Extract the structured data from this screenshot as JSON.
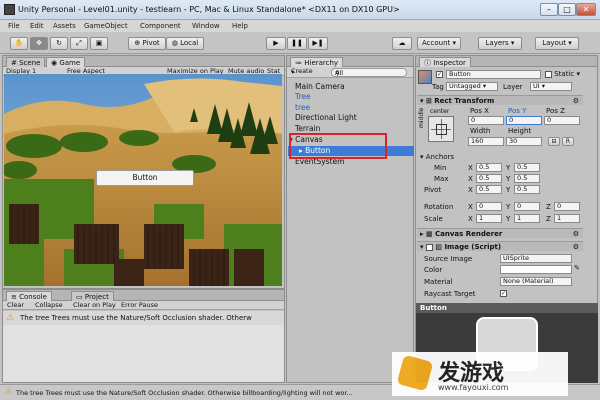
{
  "window": {
    "title": "Unity Personal - Level01.unity - testlearn - PC, Mac & Linux Standalone* <DX11 on DX10 GPU>",
    "controls": [
      "–",
      "□",
      "✕"
    ]
  },
  "menu": [
    "File",
    "Edit",
    "Assets",
    "GameObject",
    "Component",
    "Window",
    "Help"
  ],
  "toolbar": {
    "pivot": "Pivot",
    "local": "Local",
    "account": "Account",
    "layers": "Layers",
    "layout": "Layout"
  },
  "scene_panel": {
    "tabs": [
      "Scene",
      "Game"
    ],
    "display": "Display 1",
    "aspect": "Free Aspect",
    "options": [
      "Maximize on Play",
      "Mute audio",
      "Stat"
    ],
    "game_button": "Button"
  },
  "console_panel": {
    "tabs": [
      "Console",
      "Project"
    ],
    "buttons": [
      "Clear",
      "Collapse",
      "Clear on Play",
      "Error Pause"
    ],
    "message": "The tree Trees must use the Nature/Soft Occlusion shader. Otherw"
  },
  "hierarchy": {
    "tab": "Hierarchy",
    "create": "Create",
    "search": "All",
    "items": [
      "Main Camera",
      "Tree",
      "tree",
      "Directional Light",
      "Terrain",
      "Canvas",
      "Button",
      "EventSystem"
    ]
  },
  "inspector": {
    "tab": "Inspector",
    "object_name": "Button",
    "static_label": "Static",
    "tag_label": "Tag",
    "tag_value": "Untagged",
    "layer_label": "Layer",
    "layer_value": "UI",
    "rect_transform": {
      "header": "Rect Transform",
      "anchor_label": "center",
      "side_label": "middle",
      "pos_labels": [
        "Pos X",
        "Pos Y",
        "Pos Z"
      ],
      "pos_values": [
        "0",
        "0",
        "0"
      ],
      "size_labels": [
        "Width",
        "Height"
      ],
      "size_values": [
        "160",
        "30"
      ],
      "anchors_label": "Anchors",
      "min_label": "Min",
      "min_values": [
        "0.5",
        "0.5"
      ],
      "max_label": "Max",
      "max_values": [
        "0.5",
        "0.5"
      ],
      "pivot_label": "Pivot",
      "pivot_values": [
        "0.5",
        "0.5"
      ],
      "rotation_label": "Rotation",
      "rotation_values": [
        "0",
        "0",
        "0"
      ],
      "scale_label": "Scale",
      "scale_values": [
        "1",
        "1",
        "1"
      ],
      "axis_labels": [
        "X",
        "Y",
        "Z"
      ],
      "r_button": "R"
    },
    "canvas_renderer": "Canvas Renderer",
    "image": {
      "header": "Image (Script)",
      "source_label": "Source Image",
      "source_value": "UISprite",
      "color_label": "Color",
      "material_label": "Material",
      "material_value": "None (Material)",
      "raycast_label": "Raycast Target"
    },
    "preview_title": "Button"
  },
  "status": {
    "message": "The tree Trees must use the Nature/Soft Occlusion shader. Otherwise billboarding/lighting will not wor..."
  },
  "watermark": {
    "main": "发游戏",
    "url": "www.fayouxi.com"
  },
  "colors": {
    "selection": "#3e7bd6",
    "highlight_box": "#d9232a",
    "hierarchy_blue": "#2a5db5"
  }
}
